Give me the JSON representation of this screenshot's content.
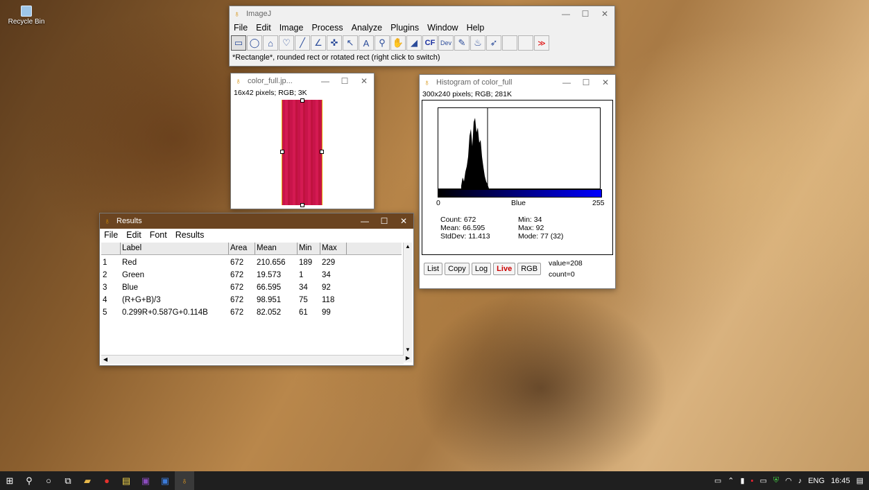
{
  "desktop": {
    "recycle_bin": "Recycle Bin"
  },
  "imagej": {
    "title": "ImageJ",
    "menu": [
      "File",
      "Edit",
      "Image",
      "Process",
      "Analyze",
      "Plugins",
      "Window",
      "Help"
    ],
    "tools": [
      "rectangle-icon",
      "oval-icon",
      "polygon-icon",
      "freehand-icon",
      "line-icon",
      "angle-icon",
      "multipoint-icon",
      "wand-icon",
      "text-icon",
      "magnifier-icon",
      "hand-icon",
      "dropper-icon",
      "cf-button",
      "dev-button",
      "brush-icon",
      "flood-icon",
      "arrow-icon",
      "blank",
      "blank",
      "more-icon"
    ],
    "cf_label": "CF",
    "dev_label": "Dev",
    "status": "*Rectangle*, rounded rect or rotated rect (right click to switch)"
  },
  "image_window": {
    "title": "color_full.jp...",
    "info": "16x42 pixels; RGB; 3K"
  },
  "histogram": {
    "title": "Histogram of color_full",
    "info": "300x240 pixels; RGB; 281K",
    "axis_min": "0",
    "axis_label": "Blue",
    "axis_max": "255",
    "count": "Count: 672",
    "mean": "Mean: 66.595",
    "stddev": "StdDev: 11.413",
    "min": "Min: 34",
    "max": "Max: 92",
    "mode": "Mode: 77 (32)",
    "buttons": [
      "List",
      "Copy",
      "Log",
      "Live",
      "RGB"
    ],
    "value": "value=208",
    "count_cursor": "count=0"
  },
  "results": {
    "title": "Results",
    "menu": [
      "File",
      "Edit",
      "Font",
      "Results"
    ],
    "columns": [
      "",
      "Label",
      "Area",
      "Mean",
      "Min",
      "Max"
    ],
    "rows": [
      [
        "1",
        "Red",
        "672",
        "210.656",
        "189",
        "229"
      ],
      [
        "2",
        "Green",
        "672",
        "19.573",
        "1",
        "34"
      ],
      [
        "3",
        "Blue",
        "672",
        "66.595",
        "34",
        "92"
      ],
      [
        "4",
        "(R+G+B)/3",
        "672",
        "98.951",
        "75",
        "118"
      ],
      [
        "5",
        "0.299R+0.587G+0.114B",
        "672",
        "82.052",
        "61",
        "99"
      ]
    ]
  },
  "taskbar": {
    "lang": "ENG",
    "time": "16:45"
  }
}
